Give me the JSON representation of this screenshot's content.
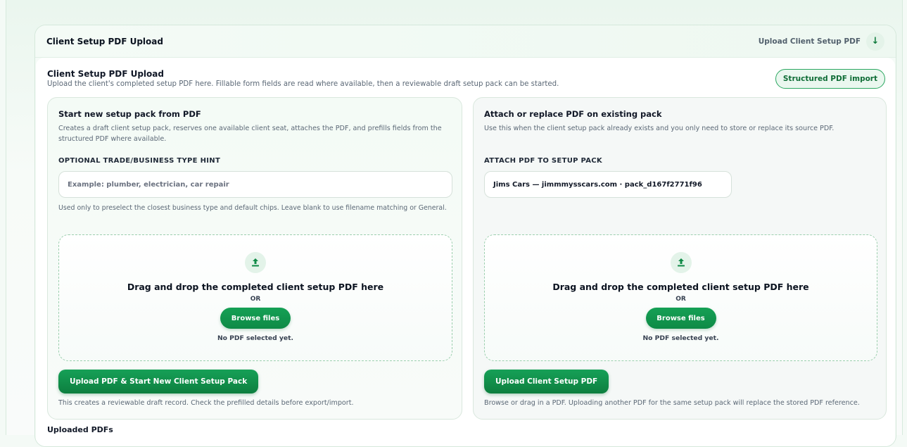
{
  "panel": {
    "title": "Client Setup PDF Upload",
    "header_link": "Upload Client Setup PDF",
    "toggle_glyph": "↓"
  },
  "section": {
    "title": "Client Setup PDF Upload",
    "subtitle": "Upload the client's completed setup PDF here. Fillable form fields are read where available, then a reviewable draft setup pack can be started.",
    "badge": "Structured PDF import"
  },
  "new_pack": {
    "title": "Start new setup pack from PDF",
    "description": "Creates a draft client setup pack, reserves one available client seat, attaches the PDF, and prefills fields from the structured PDF where available.",
    "field_label": "OPTIONAL TRADE/BUSINESS TYPE HINT",
    "field_placeholder": "Example: plumber, electrician, car repair",
    "field_hint": "Used only to preselect the closest business type and default chips. Leave blank to use filename matching or General.",
    "dropzone": {
      "icon": "upload-icon",
      "title": "Drag and drop the completed client setup PDF here",
      "or": "OR",
      "browse": "Browse files",
      "status": "No PDF selected yet."
    },
    "button": "Upload PDF & Start New Client Setup Pack",
    "footnote": "This creates a reviewable draft record. Check the prefilled details before export/import."
  },
  "existing_pack": {
    "title": "Attach or replace PDF on existing pack",
    "description": "Use this when the client setup pack already exists and you only need to store or replace its source PDF.",
    "field_label": "ATTACH PDF TO SETUP PACK",
    "selected_pack": "Jims Cars — jimmmysscars.com · pack_d167f2771f96",
    "dropzone": {
      "icon": "upload-icon",
      "title": "Drag and drop the completed client setup PDF here",
      "or": "OR",
      "browse": "Browse files",
      "status": "No PDF selected yet."
    },
    "button": "Upload Client Setup PDF",
    "footnote": "Browse or drag in a PDF. Uploading another PDF for the same setup pack will replace the stored PDF reference."
  },
  "uploaded_heading": "Uploaded PDFs",
  "colors": {
    "accent": "#0f8a46",
    "accent_light": "#e3f3e9",
    "border": "#d9e7dd"
  }
}
